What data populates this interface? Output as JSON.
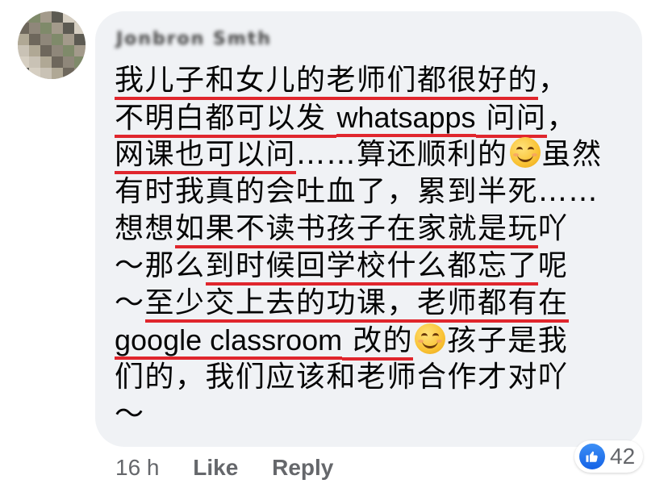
{
  "comment": {
    "author": "Jonbron Smth",
    "lines": [
      [
        {
          "t": "我儿子和女儿的老师们都很好的",
          "u": true
        },
        {
          "t": "，",
          "u": false
        }
      ],
      [
        {
          "t": "不明白都可以发 ",
          "u": true
        },
        {
          "t": "whatsapps",
          "u": true,
          "latin": true
        },
        {
          "t": " 问问",
          "u": true
        },
        {
          "t": "，",
          "u": false
        }
      ],
      [
        {
          "t": "网课也可以问",
          "u": true
        },
        {
          "t": "……算还顺利的",
          "u": false
        },
        {
          "t": "EMOJI",
          "u": false
        },
        {
          "t": "虽然",
          "u": false
        }
      ],
      [
        {
          "t": "有时我真的会吐血了，累到半死……",
          "u": false
        }
      ],
      [
        {
          "t": "想想",
          "u": false
        },
        {
          "t": "如果不读书孩子在家就是玩",
          "u": true
        },
        {
          "t": "吖",
          "u": false
        }
      ],
      [
        {
          "t": "～那么",
          "u": false
        },
        {
          "t": "到时候回学校什么都忘了",
          "u": true
        },
        {
          "t": "呢",
          "u": false
        }
      ],
      [
        {
          "t": "～",
          "u": false
        },
        {
          "t": "至少交上去的功课，老师都有在",
          "u": true
        }
      ],
      [
        {
          "t": "google classroom",
          "u": true,
          "latin": true
        },
        {
          "t": " 改的",
          "u": true
        },
        {
          "t": "EMOJI",
          "u": false
        },
        {
          "t": "孩子是我",
          "u": false
        }
      ],
      [
        {
          "t": "们的，我们应该和老师合作才对吖",
          "u": false
        }
      ],
      [
        {
          "t": "～",
          "u": false
        }
      ]
    ]
  },
  "footer": {
    "time": "16 h",
    "like_label": "Like",
    "reply_label": "Reply"
  },
  "reaction": {
    "icon": "thumbs-up-icon",
    "count": "42"
  },
  "colors": {
    "underline": "#e0262d",
    "bubble": "#f0f2f5",
    "meta_text": "#65676b",
    "like_blue": "#1877f2"
  }
}
